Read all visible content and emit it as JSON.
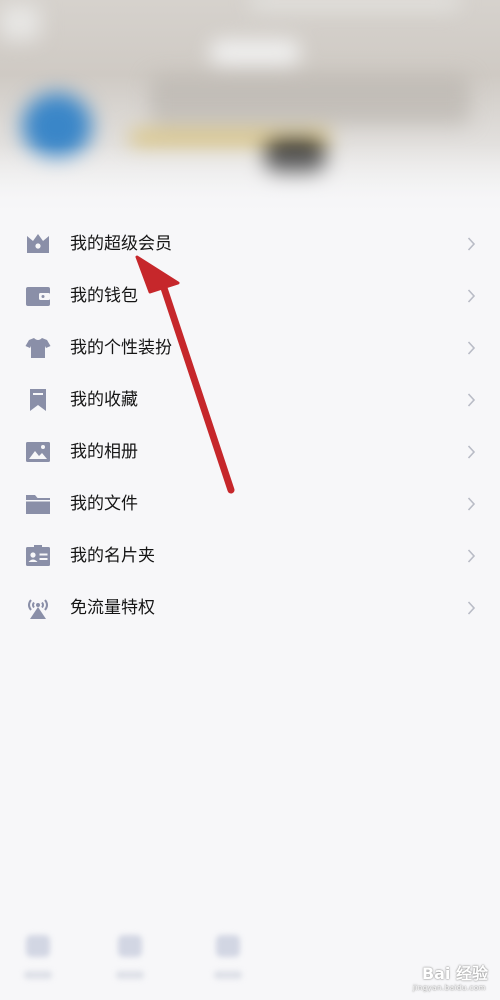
{
  "menu": {
    "items": [
      {
        "label": "我的超级会员",
        "icon": "crown-icon"
      },
      {
        "label": "我的钱包",
        "icon": "wallet-icon"
      },
      {
        "label": "我的个性装扮",
        "icon": "tshirt-icon"
      },
      {
        "label": "我的收藏",
        "icon": "bookmark-icon"
      },
      {
        "label": "我的相册",
        "icon": "photo-icon"
      },
      {
        "label": "我的文件",
        "icon": "folder-icon"
      },
      {
        "label": "我的名片夹",
        "icon": "id-card-icon"
      },
      {
        "label": "免流量特权",
        "icon": "signal-tower-icon"
      }
    ]
  },
  "watermark": {
    "text": "Bai 经验",
    "sub": "jingyan.baidu.com"
  },
  "colors": {
    "icon": "#8a8fa8",
    "chevron": "#b9bcc6",
    "arrow": "#c6272b",
    "text": "#151515"
  }
}
